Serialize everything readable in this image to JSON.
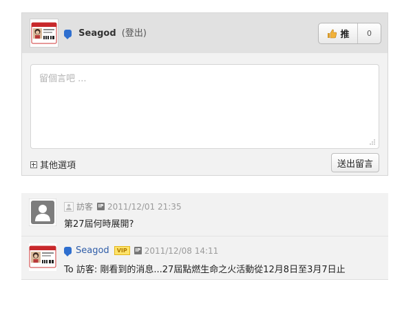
{
  "composer": {
    "username": "Seagod",
    "logout_label": "(登出)",
    "push_label": "推",
    "push_count": "0",
    "placeholder": "留個言吧 ...",
    "options_label": "其他選項",
    "submit_label": "送出留言"
  },
  "comments": [
    {
      "author": "訪客",
      "date": "2011/12/01 21:35",
      "ip_badge": "IP",
      "text": "第27屆何時展開?"
    },
    {
      "author": "Seagod",
      "vip_badge": "VIP",
      "ip_badge": "IP",
      "date": "2011/12/08 14:11",
      "text": "To 訪客: 剛看到的消息...27屆點燃生命之火活動從12月8日至3月7日止"
    }
  ],
  "colors": {
    "panel_bg": "#f2f2f2",
    "header_bg": "#e1e1e1",
    "link_blue": "#2f5da8",
    "service_icon": "#2f6fcf",
    "vip_yellow": "#fde36a"
  },
  "icons": {
    "service": "chat-bubble-icon",
    "like": "thumbs-up-icon",
    "guest": "guest-user-icon",
    "avatar": "id-card-avatar"
  }
}
